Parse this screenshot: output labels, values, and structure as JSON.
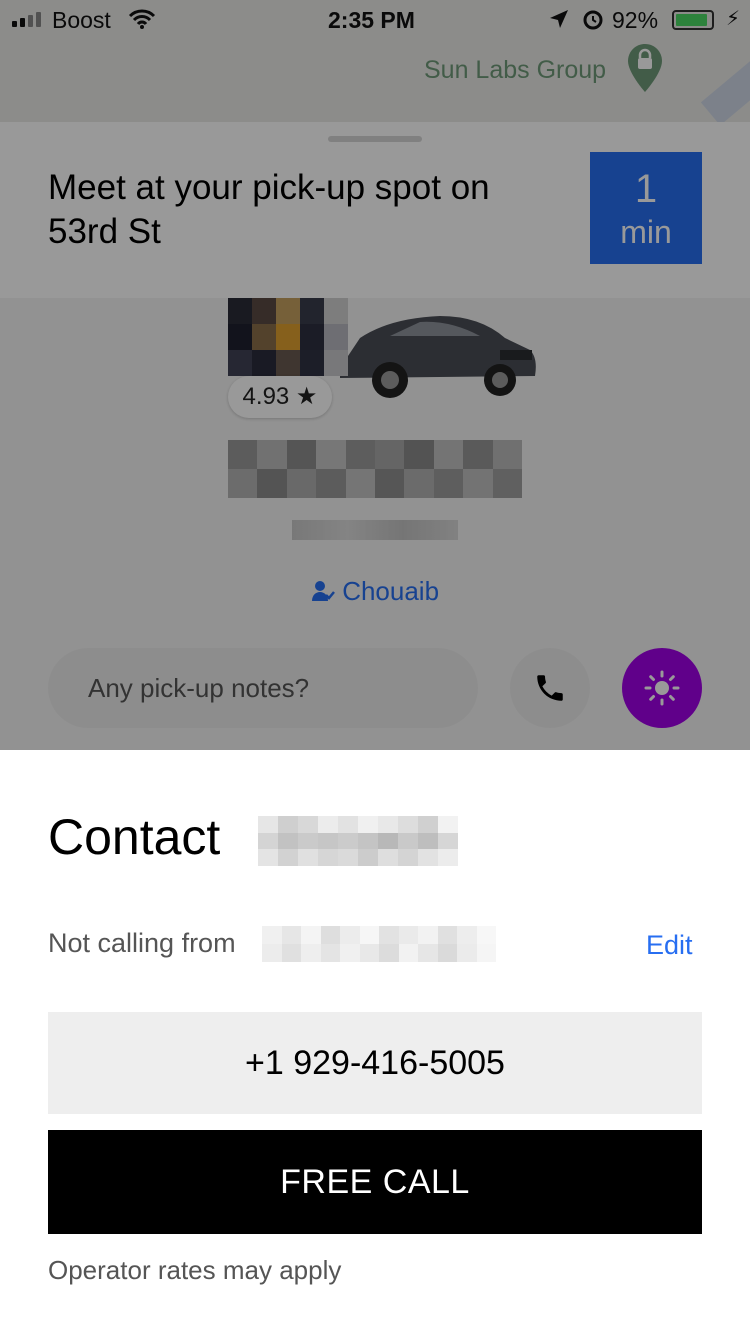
{
  "status_bar": {
    "carrier": "Boost",
    "time": "2:35 PM",
    "battery": "92%",
    "battery_level": 0.92
  },
  "map": {
    "place_label": "Sun Labs Group"
  },
  "trip_card": {
    "title": "Meet at your pick-up spot on 53rd St",
    "eta_value": "1",
    "eta_unit": "min"
  },
  "driver": {
    "rating": "4.93 ★",
    "rider_name": "Chouaib"
  },
  "notes": {
    "placeholder": "Any pick-up notes?"
  },
  "contact_sheet": {
    "title": "Contact",
    "not_calling_from": "Not calling from",
    "edit_label": "Edit",
    "phone_number": "+1 929-416-5005",
    "free_call_label": "FREE CALL",
    "operator_note": "Operator rates may apply"
  },
  "colors": {
    "accent_blue": "#276ef1",
    "beacon_purple": "#a100e6",
    "button_black": "#000000",
    "battery_green": "#4cd964"
  },
  "icons": {
    "signal": "signal-icon",
    "wifi": "wifi-icon",
    "location": "location-arrow-icon",
    "alarm": "alarm-icon",
    "battery": "battery-icon",
    "charging": "bolt-icon",
    "map_pin": "map-pin-icon",
    "star": "star-icon",
    "rider": "person-icon",
    "phone": "phone-icon",
    "beacon": "beacon-icon"
  }
}
